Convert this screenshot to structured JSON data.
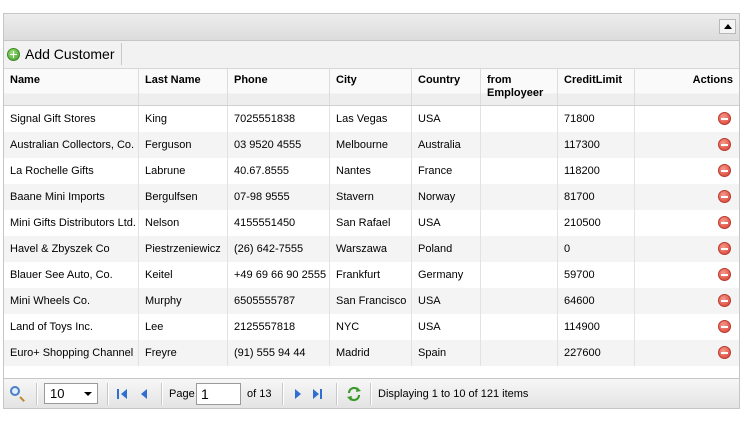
{
  "toolbar": {
    "add_label": "Add Customer"
  },
  "columns": [
    "Name",
    "Last Name",
    "Phone",
    "City",
    "Country",
    "from Employeer",
    "CreditLimit",
    "Actions"
  ],
  "rows": [
    [
      "Signal Gift Stores",
      "King",
      "7025551838",
      "Las Vegas",
      "USA",
      "",
      "71800"
    ],
    [
      "Australian Collectors, Co.",
      "Ferguson",
      "03 9520 4555",
      "Melbourne",
      "Australia",
      "",
      "117300"
    ],
    [
      "La Rochelle Gifts",
      "Labrune",
      "40.67.8555",
      "Nantes",
      "France",
      "",
      "118200"
    ],
    [
      "Baane Mini Imports",
      "Bergulfsen",
      "07-98 9555",
      "Stavern",
      "Norway",
      "",
      "81700"
    ],
    [
      "Mini Gifts Distributors Ltd.",
      "Nelson",
      "4155551450",
      "San Rafael",
      "USA",
      "",
      "210500"
    ],
    [
      "Havel & Zbyszek Co",
      "Piestrzeniewicz",
      "(26) 642-7555",
      "Warszawa",
      "Poland",
      "",
      "0"
    ],
    [
      "Blauer See Auto, Co.",
      "Keitel",
      "+49 69 66 90 2555",
      "Frankfurt",
      "Germany",
      "",
      "59700"
    ],
    [
      "Mini Wheels Co.",
      "Murphy",
      "6505555787",
      "San Francisco",
      "USA",
      "",
      "64600"
    ],
    [
      "Land of Toys Inc.",
      "Lee",
      "2125557818",
      "NYC",
      "USA",
      "",
      "114900"
    ],
    [
      "Euro+ Shopping Channel",
      "Freyre",
      "(91) 555 94 44",
      "Madrid",
      "Spain",
      "",
      "227600"
    ]
  ],
  "pager": {
    "page_size": "10",
    "page_label": "Page",
    "page_value": "1",
    "of_label": "of 13",
    "display_text": "Displaying 1 to 10 of 121 items"
  },
  "colors": {
    "nav_blue": "#2f6fd1",
    "add_green": "#3f9b27",
    "delete_red": "#d8392a"
  }
}
